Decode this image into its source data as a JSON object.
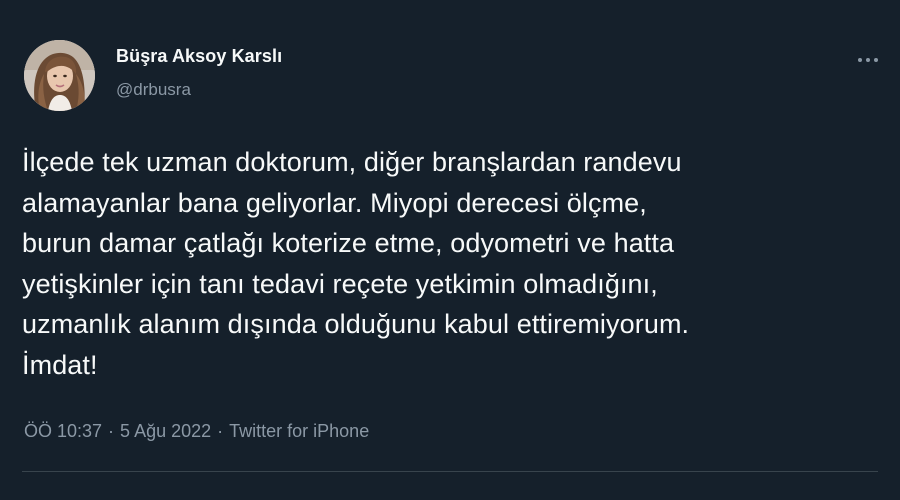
{
  "author": {
    "display_name": "Büşra Aksoy Karslı",
    "handle": "@drbusra",
    "avatar_icon": "profile-photo"
  },
  "more_icon": "more-horizontal-icon",
  "tweet": {
    "lines": [
      "İlçede tek uzman doktorum, diğer branşlardan randevu",
      "alamayanlar bana geliyorlar. Miyopi derecesi ölçme,",
      "burun damar çatlağı koterize etme, odyometri ve hatta",
      "yetişkinler için tanı tedavi reçete yetkimin olmadığını,",
      "uzmanlık alanım dışında olduğunu kabul ettiremiyorum.",
      "İmdat!"
    ]
  },
  "meta": {
    "time": "ÖÖ 10:37",
    "separator": "·",
    "date": "5 Ağu 2022",
    "source": "Twitter for iPhone"
  },
  "colors": {
    "background": "#15202b",
    "text": "#f7f9f9",
    "secondary": "#8b98a5",
    "divider": "#38444d"
  }
}
